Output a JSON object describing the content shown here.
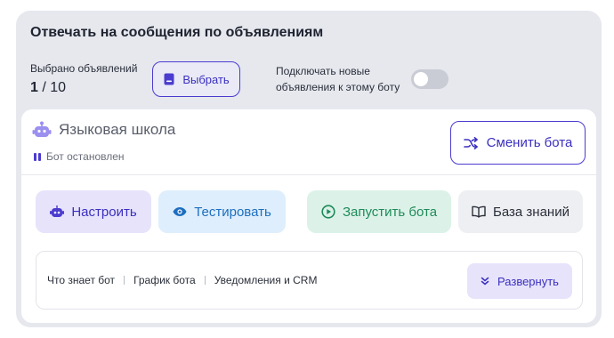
{
  "header": {
    "title": "Отвечать на сообщения по объявлениям"
  },
  "selection": {
    "label": "Выбрано объявлений",
    "count_selected": "1",
    "count_separator": " / ",
    "count_total": "10",
    "select_button": "Выбрать"
  },
  "auto_connect": {
    "label": "Подключать новые объявления к этому боту",
    "enabled": false
  },
  "bot": {
    "name": "Языковая школа",
    "status": "Бот остановлен",
    "change_button": "Сменить бота"
  },
  "actions": {
    "setup": "Настроить",
    "test": "Тестировать",
    "run": "Запустить бота",
    "knowledge": "База знаний"
  },
  "links": {
    "knows": "Что знает бот",
    "schedule": "График бота",
    "notifications": "Уведомления и CRM",
    "expand_button": "Развернуть"
  },
  "colors": {
    "accent": "#4b3ccf",
    "test": "#1d6fc0",
    "run": "#1f8a5a",
    "card_bg": "#e6e8ee"
  }
}
